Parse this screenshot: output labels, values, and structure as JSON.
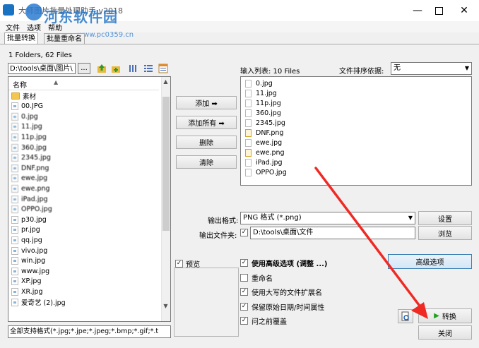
{
  "window": {
    "title": "大师图片批量处理助手 v2018",
    "minimize_icon": "minimize-icon",
    "maximize_icon": "maximize-icon",
    "close_icon": "close-icon"
  },
  "watermark": {
    "line1": "河东软件园",
    "line2": "www.pc0359.cn"
  },
  "menu": [
    "文件",
    "选项",
    "帮助"
  ],
  "tabs": [
    "批量转换",
    "批量重命名"
  ],
  "left": {
    "folder_count": "1 Folders, 62 Files",
    "path": "D:\\tools\\桌面\\图片\\",
    "browse": "...",
    "column_header": "名称",
    "files": [
      {
        "name": "素材",
        "folder": true
      },
      {
        "name": "00.JPG"
      },
      {
        "name": "0.jpg"
      },
      {
        "name": "11.jpg"
      },
      {
        "name": "11p.jpg"
      },
      {
        "name": "360.jpg"
      },
      {
        "name": "2345.jpg"
      },
      {
        "name": "DNF.png"
      },
      {
        "name": "ewe.jpg"
      },
      {
        "name": "ewe.png"
      },
      {
        "name": "iPad.jpg"
      },
      {
        "name": "OPPO.jpg"
      },
      {
        "name": "p30.jpg"
      },
      {
        "name": "pr.jpg"
      },
      {
        "name": "qq.jpg"
      },
      {
        "name": "vivo.jpg"
      },
      {
        "name": "win.jpg"
      },
      {
        "name": "www.jpg"
      },
      {
        "name": "XP.jpg"
      },
      {
        "name": "XR.jpg"
      },
      {
        "name": "爱奇艺 (2).jpg"
      }
    ],
    "filter": "全部支持格式(*.jpg;*.jpe;*.jpeg;*.bmp;*.gif;*.t"
  },
  "middle_buttons": {
    "add": "添加 ➡",
    "add_all": "添加所有 ➡",
    "delete": "删除",
    "clear": "清除"
  },
  "right": {
    "input_list_label": "输入列表: 10 Files",
    "sort_label": "文件排序依据:",
    "sort_value": "无",
    "input_files": [
      {
        "name": "0.jpg"
      },
      {
        "name": "11.jpg"
      },
      {
        "name": "11p.jpg"
      },
      {
        "name": "360.jpg"
      },
      {
        "name": "2345.jpg"
      },
      {
        "name": "DNF.png",
        "alt": true
      },
      {
        "name": "ewe.jpg"
      },
      {
        "name": "ewe.png",
        "alt": true
      },
      {
        "name": "iPad.jpg"
      },
      {
        "name": "OPPO.jpg"
      }
    ],
    "output_format_label": "输出格式:",
    "output_format_value": "PNG 格式 (*.png)",
    "settings_button": "设置",
    "output_folder_label": "输出文件夹:",
    "output_folder_value": "D:\\tools\\桌面\\文件",
    "browse_button": "浏览",
    "preview_label": "预览",
    "advanced_button": "高级选项",
    "options": [
      {
        "label": "使用高级选项 (调整 ...)",
        "checked": true,
        "bold": true
      },
      {
        "label": "重命名",
        "checked": false
      },
      {
        "label": "使用大写的文件扩展名",
        "checked": true
      },
      {
        "label": "保留原始日期/时间属性",
        "checked": true
      },
      {
        "label": "问之前覆盖",
        "checked": true
      }
    ],
    "convert_button": "转换",
    "close_button": "关闭"
  },
  "colors": {
    "accent_blue": "#1a72c2",
    "annotation_red": "#ef2a25",
    "convert_play": "#1fa31f"
  }
}
